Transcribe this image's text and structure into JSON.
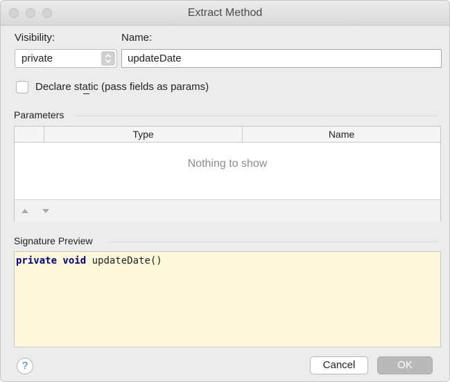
{
  "window": {
    "title": "Extract Method"
  },
  "form": {
    "visibility_label": "Visibility:",
    "visibility_value": "private",
    "name_label": "Name:",
    "name_value": "updateDate",
    "declare_static_label": "Declare static (pass fields as params)",
    "declare_static_checked": false
  },
  "parameters": {
    "section_label": "Parameters",
    "columns": [
      "",
      "Type",
      "Name"
    ],
    "empty_text": "Nothing to show",
    "rows": []
  },
  "signature": {
    "section_label": "Signature Preview",
    "keywords": "private void",
    "method": " updateDate()"
  },
  "buttons": {
    "help": "?",
    "cancel": "Cancel",
    "ok": "OK"
  },
  "colors": {
    "preview_background": "#fdf7dc",
    "keyword": "#000080",
    "help_icon": "#3a7bd5",
    "ok_disabled": "#b9b9b9"
  }
}
